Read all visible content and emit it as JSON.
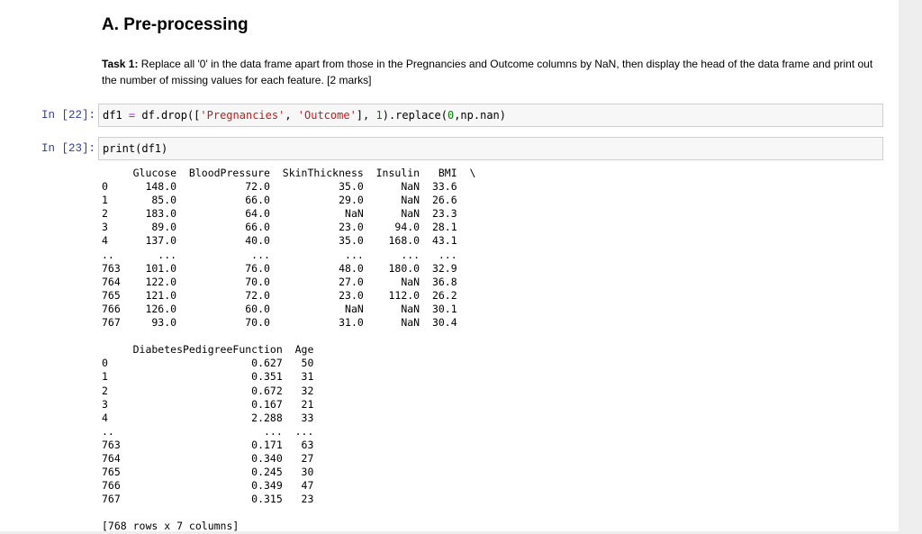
{
  "section": {
    "heading": "A. Pre-processing"
  },
  "task": {
    "label": "Task 1:",
    "text": " Replace all '0' in the data frame apart from those in the Pregnancies and Outcome columns by NaN, then display the head of the data frame and print out the number of missing values for each feature. [2 marks]"
  },
  "cells": [
    {
      "prompt": "In [22]:",
      "code": {
        "t1": "df1 ",
        "t2": "=",
        "t3": " df.drop([",
        "t4": "'Pregnancies'",
        "t5": ", ",
        "t6": "'Outcome'",
        "t7": "], ",
        "t8": "1",
        "t9": ").replace(",
        "t10": "0",
        "t11": ",np.nan)"
      }
    },
    {
      "prompt": "In [23]:",
      "code": {
        "t1": "print(df1)"
      }
    }
  ],
  "output": {
    "lines": [
      "     Glucose  BloodPressure  SkinThickness  Insulin   BMI  \\",
      "0      148.0           72.0           35.0      NaN  33.6   ",
      "1       85.0           66.0           29.0      NaN  26.6   ",
      "2      183.0           64.0            NaN      NaN  23.3   ",
      "3       89.0           66.0           23.0     94.0  28.1   ",
      "4      137.0           40.0           35.0    168.0  43.1   ",
      "..       ...            ...            ...      ...   ...   ",
      "763    101.0           76.0           48.0    180.0  32.9   ",
      "764    122.0           70.0           27.0      NaN  36.8   ",
      "765    121.0           72.0           23.0    112.0  26.2   ",
      "766    126.0           60.0            NaN      NaN  30.1   ",
      "767     93.0           70.0           31.0      NaN  30.4   ",
      "",
      "     DiabetesPedigreeFunction  Age  ",
      "0                       0.627   50  ",
      "1                       0.351   31  ",
      "2                       0.672   32  ",
      "3                       0.167   21  ",
      "4                       2.288   33  ",
      "..                        ...  ...  ",
      "763                     0.171   63  ",
      "764                     0.340   27  ",
      "765                     0.245   30  ",
      "766                     0.349   47  ",
      "767                     0.315   23  ",
      "",
      "[768 rows x 7 columns]"
    ]
  }
}
